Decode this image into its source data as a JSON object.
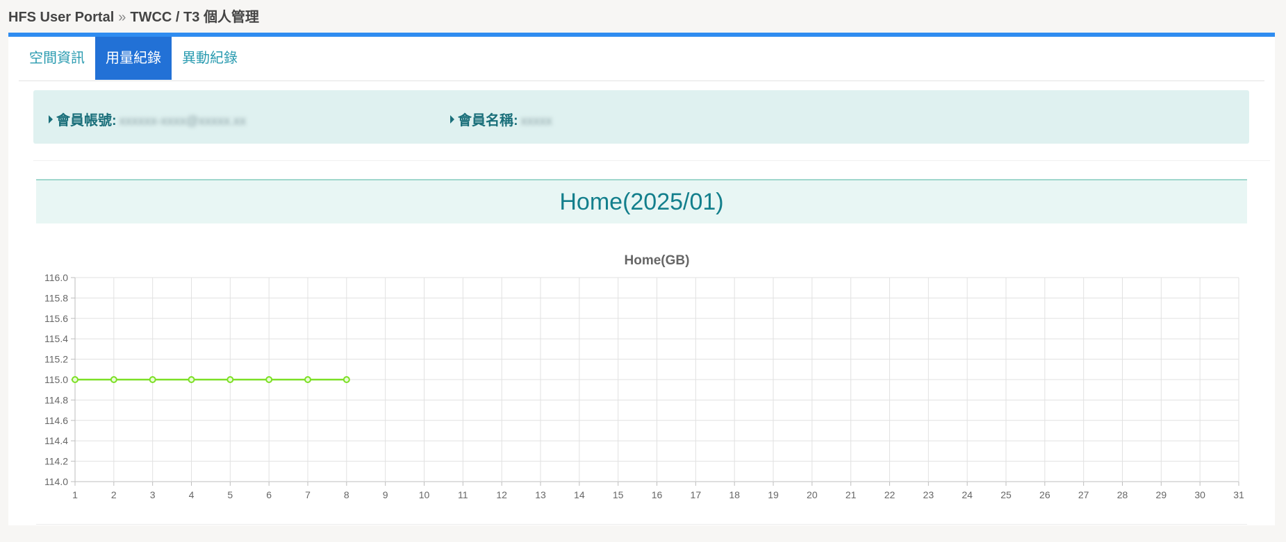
{
  "breadcrumb": {
    "root": "HFS User Portal",
    "separator": "»",
    "current": "TWCC / T3 個人管理"
  },
  "tabs": [
    {
      "label": "空間資訊",
      "active": false
    },
    {
      "label": "用量紀錄",
      "active": true
    },
    {
      "label": "異動紀錄",
      "active": false
    }
  ],
  "member": {
    "account_label": "會員帳號:",
    "account_value": "xxxxxx-xxxx@xxxxx.xx",
    "name_label": "會員名稱:",
    "name_value": "xxxxx"
  },
  "section": {
    "title": "Home(2025/01)"
  },
  "colors": {
    "accent": "#2f8cf0",
    "tab_active": "#2271d6",
    "teal_text": "#137f8c",
    "line": "#7ce025"
  },
  "chart_data": {
    "type": "line",
    "title": "Home(GB)",
    "x": [
      1,
      2,
      3,
      4,
      5,
      6,
      7,
      8,
      9,
      10,
      11,
      12,
      13,
      14,
      15,
      16,
      17,
      18,
      19,
      20,
      21,
      22,
      23,
      24,
      25,
      26,
      27,
      28,
      29,
      30,
      31
    ],
    "series": [
      {
        "values": [
          115.0,
          115.0,
          115.0,
          115.0,
          115.0,
          115.0,
          115.0,
          115.0,
          null,
          null,
          null,
          null,
          null,
          null,
          null,
          null,
          null,
          null,
          null,
          null,
          null,
          null,
          null,
          null,
          null,
          null,
          null,
          null,
          null,
          null,
          null
        ]
      }
    ],
    "ylim": [
      114.0,
      116.0
    ],
    "yticks": [
      "114.0",
      "114.2",
      "114.4",
      "114.6",
      "114.8",
      "115.0",
      "115.2",
      "115.4",
      "115.6",
      "115.8",
      "116.0"
    ],
    "grid": true
  }
}
